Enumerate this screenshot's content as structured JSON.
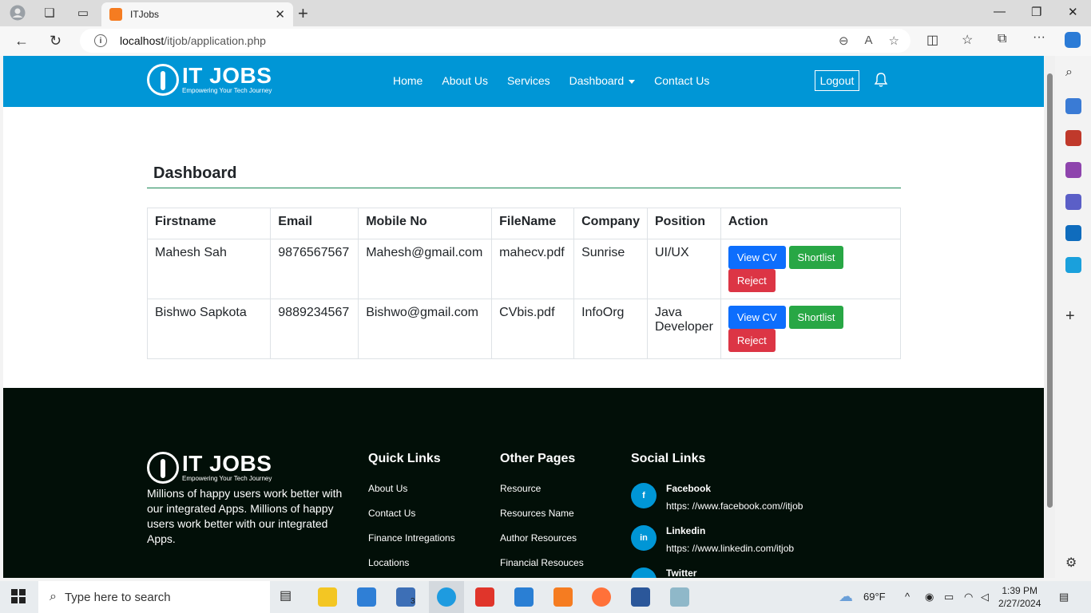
{
  "browser": {
    "tab_title": "ITJobs",
    "url_host": "localhost",
    "url_path": "/itjob/application.php"
  },
  "site": {
    "brand": "IT JOBS",
    "tagline": "Empowering Your Tech Journey",
    "nav": [
      "Home",
      "About Us",
      "Services",
      "Dashboard",
      "Contact Us"
    ],
    "logout_label": "Logout",
    "accent_color": "#0096d6"
  },
  "dashboard": {
    "title": "Dashboard",
    "columns": [
      "Firstname",
      "Email",
      "Mobile No",
      "FileName",
      "Company",
      "Position",
      "Action"
    ],
    "rows": [
      [
        "Mahesh Sah",
        "9876567567",
        "Mahesh@gmail.com",
        "mahecv.pdf",
        "Sunrise",
        "UI/UX"
      ],
      [
        "Bishwo Sapkota",
        "9889234567",
        "Bishwo@gmail.com",
        "CVbis.pdf",
        "InfoOrg",
        "Java Developer"
      ]
    ],
    "actions": {
      "view": "View CV",
      "shortlist": "Shortlist",
      "reject": "Reject"
    }
  },
  "footer": {
    "about_text": "Millions of happy users work better with our integrated Apps. Millions of happy users work better with our integrated Apps.",
    "quick_links_title": "Quick Links",
    "quick_links": [
      "About Us",
      "Contact Us",
      "Finance Intregations",
      "Locations"
    ],
    "other_pages_title": "Other Pages",
    "other_pages": [
      "Resource",
      "Resources Name",
      "Author Resources",
      "Financial Resouces"
    ],
    "social_title": "Social Links",
    "social": [
      {
        "name": "Facebook",
        "url": "https: //www.facebook.com//itjob",
        "icon": "f"
      },
      {
        "name": "Linkedin",
        "url": "https: //www.linkedin.com/itjob",
        "icon": "in"
      },
      {
        "name": "Twitter",
        "url": "",
        "icon": ""
      }
    ]
  },
  "taskbar": {
    "search_placeholder": "Type here to search",
    "weather": "69°F",
    "time": "1:39 PM",
    "date": "2/27/2024",
    "mail_badge": "3"
  }
}
